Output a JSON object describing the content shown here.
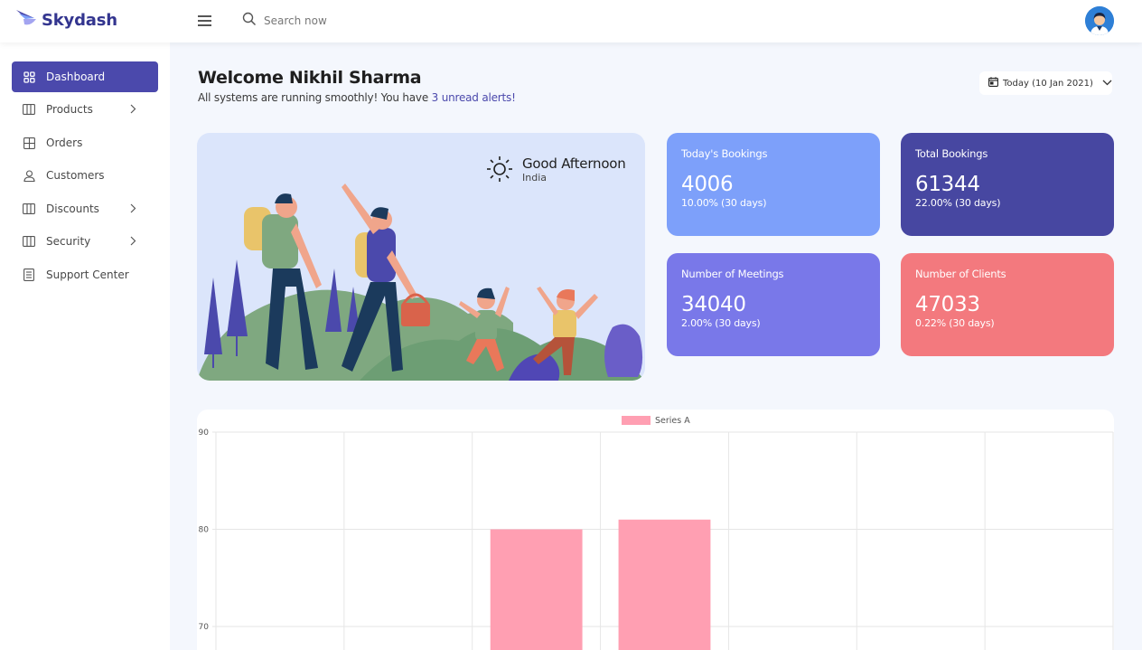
{
  "brand": {
    "name": "Skydash"
  },
  "search": {
    "placeholder": "Search now"
  },
  "sidebar": {
    "items": [
      {
        "label": "Dashboard",
        "icon": "grid-icon",
        "active": true
      },
      {
        "label": "Products",
        "icon": "columns-icon",
        "has_submenu": true
      },
      {
        "label": "Orders",
        "icon": "table-icon"
      },
      {
        "label": "Customers",
        "icon": "user-icon"
      },
      {
        "label": "Discounts",
        "icon": "columns-icon",
        "has_submenu": true
      },
      {
        "label": "Security",
        "icon": "columns-icon",
        "has_submenu": true
      },
      {
        "label": "Support Center",
        "icon": "document-icon"
      }
    ]
  },
  "header": {
    "welcome": "Welcome Nikhil Sharma",
    "subtitle_prefix": "All systems are running smoothly! You have ",
    "subtitle_link": "3 unread alerts!",
    "date_label": "Today (10 Jan 2021)"
  },
  "weather": {
    "greeting": "Good Afternoon",
    "location": "India"
  },
  "stats": [
    {
      "label": "Today's Bookings",
      "value": "4006",
      "change": "10.00% (30 days)",
      "color": "#7da0fa"
    },
    {
      "label": "Total Bookings",
      "value": "61344",
      "change": "22.00% (30 days)",
      "color": "#4747a1"
    },
    {
      "label": "Number of Meetings",
      "value": "34040",
      "change": "2.00% (30 days)",
      "color": "#7978e9"
    },
    {
      "label": "Number of Clients",
      "value": "47033",
      "change": "0.22% (30 days)",
      "color": "#f3797e"
    }
  ],
  "colors": {
    "accent": "#4b49ac",
    "bar": "#ff9fb2",
    "background": "#f4f7fd"
  },
  "chart_data": {
    "type": "bar",
    "categories": [
      "",
      "",
      "",
      "",
      "",
      "",
      ""
    ],
    "series": [
      {
        "name": "Series A",
        "values": [
          null,
          null,
          80,
          81,
          null,
          null,
          null
        ]
      }
    ],
    "yticks": [
      "90",
      "80",
      "70"
    ],
    "ylim": [
      70,
      90
    ],
    "grid": true,
    "legend": "top"
  }
}
